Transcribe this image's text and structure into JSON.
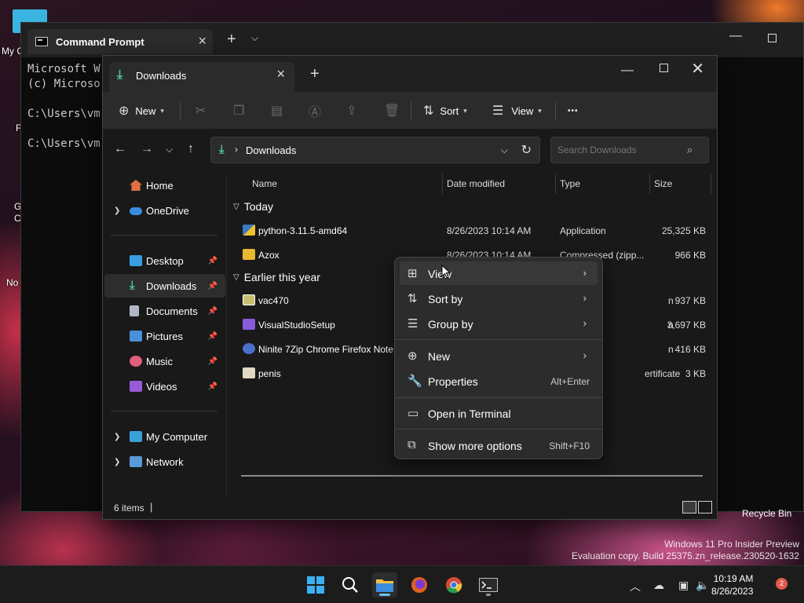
{
  "desktop": {
    "icons": [
      {
        "label": "My C"
      },
      {
        "label": "F"
      },
      {
        "label": "G"
      },
      {
        "label": "C"
      },
      {
        "label": "No"
      }
    ],
    "recycle_bin_label": "Recycle Bin",
    "watermark_line1": "Windows 11 Pro Insider Preview",
    "watermark_line2": "Evaluation copy. Build 25375.zn_release.230520-1632"
  },
  "cmd": {
    "tab_title": "Command Prompt",
    "lines": [
      "Microsoft W",
      "(c) Microso",
      "",
      "C:\\Users\\vm",
      "",
      "C:\\Users\\vm"
    ]
  },
  "explorer": {
    "tab_title": "Downloads",
    "toolbar": {
      "new_label": "New",
      "sort_label": "Sort",
      "view_label": "View",
      "more_label": "•••"
    },
    "address": {
      "path": "Downloads",
      "search_placeholder": "Search Downloads"
    },
    "sidebar": {
      "home": "Home",
      "onedrive": "OneDrive",
      "quick": [
        {
          "label": "Desktop",
          "color": "#3a9ee0"
        },
        {
          "label": "Downloads",
          "color": "#4cc2a4"
        },
        {
          "label": "Documents",
          "color": "#b0b8c8"
        },
        {
          "label": "Pictures",
          "color": "#4a90d9"
        },
        {
          "label": "Music",
          "color": "#e0607a"
        },
        {
          "label": "Videos",
          "color": "#9a5ad8"
        }
      ],
      "my_computer": "My Computer",
      "network": "Network"
    },
    "columns": {
      "name": "Name",
      "date": "Date modified",
      "type": "Type",
      "size": "Size"
    },
    "groups": {
      "today": "Today",
      "earlier": "Earlier this year"
    },
    "files_today": [
      {
        "name": "python-3.11.5-amd64",
        "date": "8/26/2023 10:14 AM",
        "type": "Application",
        "size": "25,325 KB"
      },
      {
        "name": "Azox",
        "date": "8/26/2023 10:14 AM",
        "type": "Compressed (zipp...",
        "size": "966 KB"
      }
    ],
    "files_earlier": [
      {
        "name": "vac470",
        "date": "",
        "type": "n",
        "size": "937 KB"
      },
      {
        "name": "VisualStudioSetup",
        "date": "",
        "type": "n",
        "size": "3,697 KB"
      },
      {
        "name": "Ninite 7Zip Chrome Firefox Note",
        "date": "",
        "type": "n",
        "size": "416 KB"
      },
      {
        "name": "penis",
        "date": "",
        "type": "ertificate",
        "size": "3 KB"
      }
    ],
    "status": {
      "count": "6 items",
      "caret": "|"
    }
  },
  "context_menu": {
    "view": "View",
    "sort_by": "Sort by",
    "group_by": "Group by",
    "new": "New",
    "properties": "Properties",
    "properties_shortcut": "Alt+Enter",
    "open_terminal": "Open in Terminal",
    "show_more": "Show more options",
    "show_more_shortcut": "Shift+F10"
  },
  "taskbar": {
    "time": "10:19 AM",
    "date": "8/26/2023",
    "notification_count": "2"
  }
}
